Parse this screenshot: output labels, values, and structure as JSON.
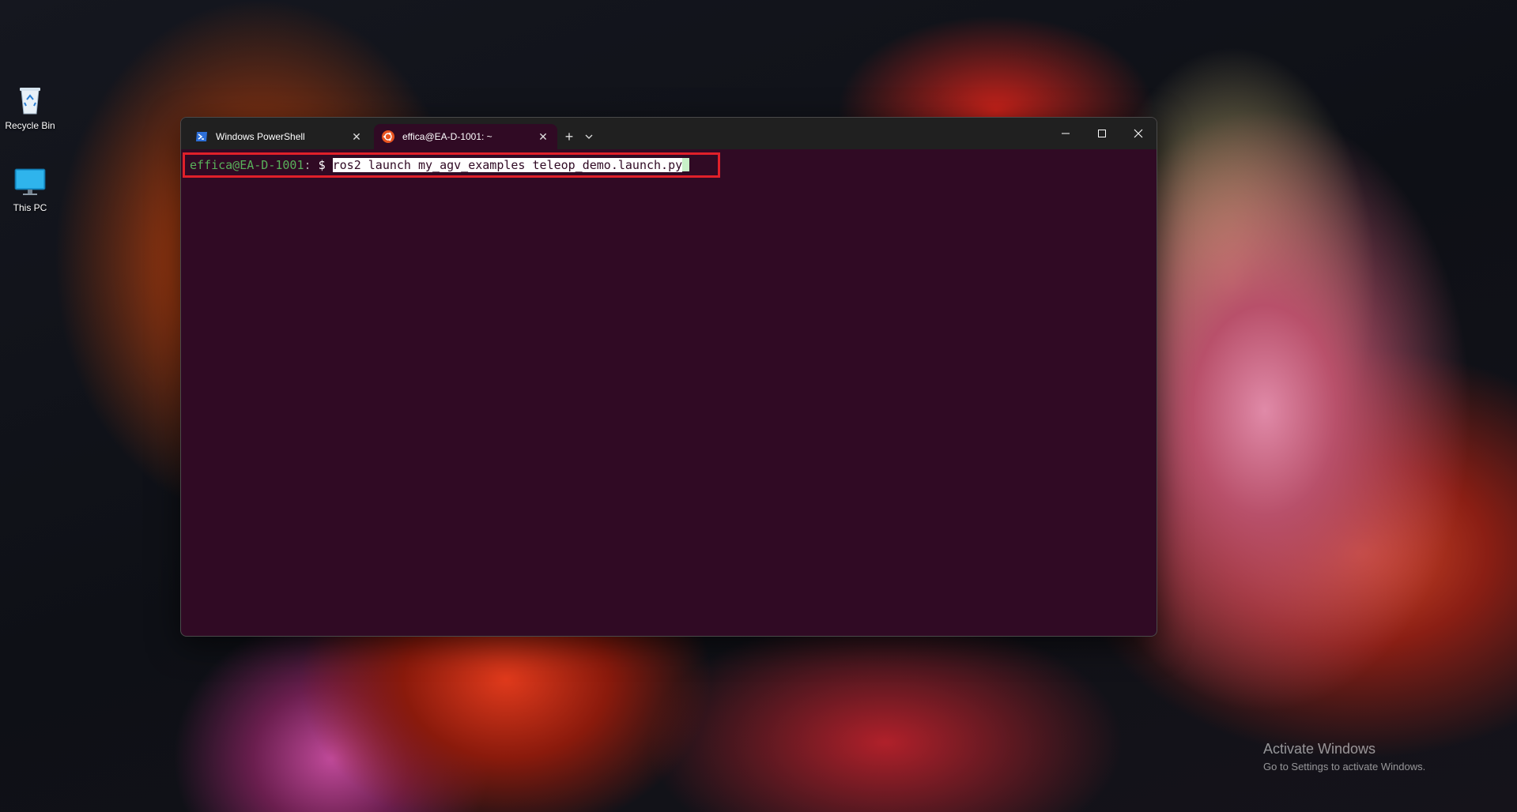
{
  "desktop": {
    "icons": [
      {
        "label": "Recycle Bin",
        "icon": "recycle-bin-icon"
      },
      {
        "label": "This PC",
        "icon": "monitor-icon"
      }
    ],
    "watermark": {
      "title": "Activate Windows",
      "subtitle": "Go to Settings to activate Windows."
    }
  },
  "terminal": {
    "tabs": [
      {
        "title": "Windows PowerShell",
        "icon": "powershell-icon",
        "active": false
      },
      {
        "title": "effica@EA-D-1001: ~",
        "icon": "ubuntu-icon",
        "active": true
      }
    ],
    "new_tab_label": "+",
    "dropdown_label": "⌄",
    "console": {
      "prompt_user": "effica@EA-D-1001",
      "prompt_sep": ":",
      "prompt_path": "~",
      "prompt_symbol": "$",
      "command": "ros2 launch my_agv_examples teleop_demo.launch.py"
    }
  },
  "colors": {
    "terminal_bg": "#300a24",
    "titlebar_bg": "#202020",
    "highlight_border": "#e0202a",
    "prompt_user": "#58b05a"
  }
}
